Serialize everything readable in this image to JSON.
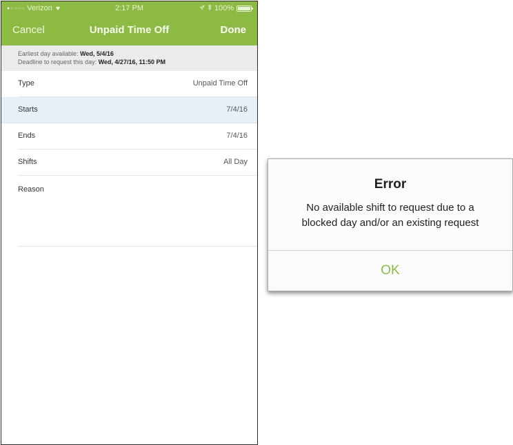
{
  "status_bar": {
    "carrier": "Verizon",
    "time": "2:17 PM",
    "battery": "100%",
    "icons": [
      "signal-dots-icon",
      "wifi-icon",
      "location-icon",
      "bluetooth-icon",
      "battery-icon"
    ]
  },
  "nav": {
    "cancel": "Cancel",
    "title": "Unpaid Time Off",
    "done": "Done"
  },
  "info": {
    "earliest_label": "Earliest day available:",
    "earliest_value": "Wed, 5/4/16",
    "deadline_label": "Deadline to request this day:",
    "deadline_value": "Wed, 4/27/16, 11:50 PM"
  },
  "form": {
    "type_label": "Type",
    "type_value": "Unpaid Time Off",
    "starts_label": "Starts",
    "starts_value": "7/4/16",
    "ends_label": "Ends",
    "ends_value": "7/4/16",
    "shifts_label": "Shifts",
    "shifts_value": "All Day",
    "reason_label": "Reason"
  },
  "alert": {
    "title": "Error",
    "message_line1": "No available shift to request due to a",
    "message_line2": "blocked day and/or an existing request",
    "ok": "OK"
  },
  "colors": {
    "accent": "#8cba42",
    "selected_row": "#e7f0f7",
    "info_bg": "#ebebeb"
  }
}
